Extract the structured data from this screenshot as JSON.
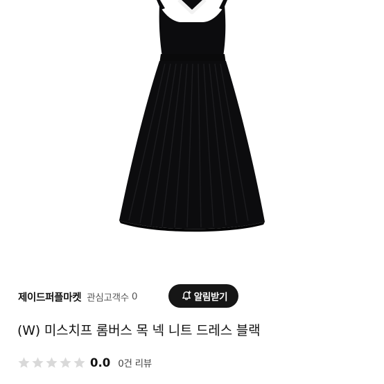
{
  "product": {
    "image_alt": "black pleated knit dress",
    "title": "(W) 미스치프 롬버스 목 넥 니트 드레스 블랙"
  },
  "seller": {
    "name": "제이드퍼플마켓",
    "favorites_label": "관심고객수",
    "favorites_count": "0"
  },
  "notify_button": {
    "icon": "bell-plus-icon",
    "label": "알림받기"
  },
  "rating": {
    "stars_filled": 0,
    "stars_total": 5,
    "value": "0.0",
    "review_count_label": "0건 리뷰"
  },
  "colors": {
    "button_bg": "#161616",
    "star_empty": "#d9d9d9",
    "dress": "#0c0c0e"
  }
}
